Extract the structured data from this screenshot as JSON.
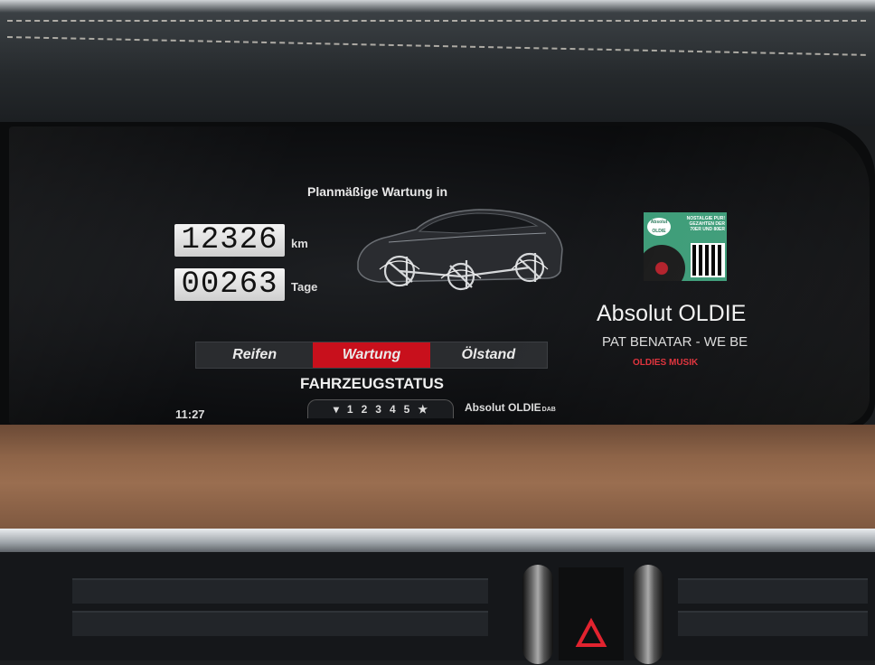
{
  "service": {
    "heading": "Planmäßige Wartung in",
    "km_value": "12326",
    "km_unit": "km",
    "days_value": "00263",
    "days_unit": "Tage"
  },
  "tabs": [
    {
      "label": "Reifen",
      "active": false
    },
    {
      "label": "Wartung",
      "active": true
    },
    {
      "label": "Ölstand",
      "active": false
    }
  ],
  "screen_title": "FAHRZEUGSTATUS",
  "pager": {
    "down_arrow": "▾",
    "pages": [
      "1",
      "2",
      "3",
      "4",
      "5"
    ],
    "favorite_icon": "★"
  },
  "clock": "11:27",
  "radio": {
    "footer_station": "Absolut OLDIE",
    "dab_logo": "DAB",
    "station": "Absolut OLDIE",
    "track": "PAT BENATAR - WE BE",
    "genre": "OLDIES MUSIK",
    "album_art_text": "NOSTALGIE PUR! GEZAHTEN DER 70ER UND 80ER",
    "album_art_logo": "Absolut OLDIE"
  },
  "colors": {
    "active_tab": "#c8101c",
    "genre_text": "#e0303a",
    "album_bg": "#3d9c78"
  }
}
